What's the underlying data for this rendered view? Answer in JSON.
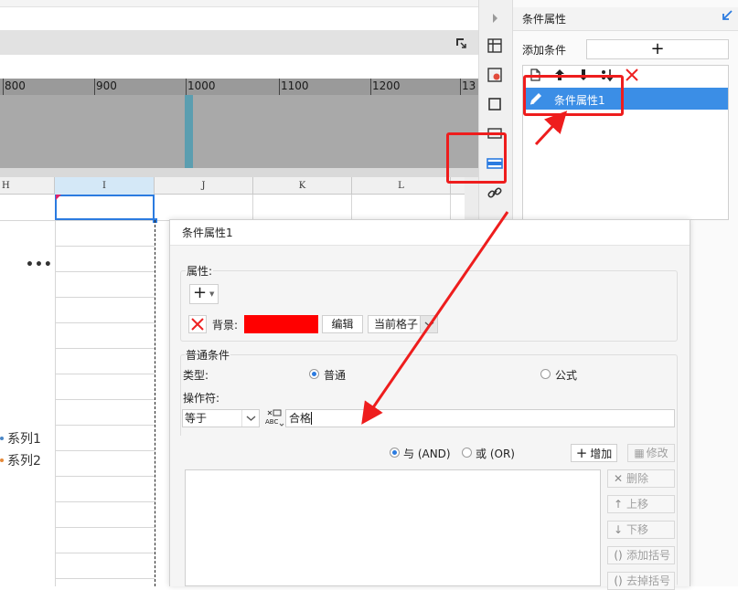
{
  "ruler": {
    "labels": [
      "800",
      "900",
      "1000",
      "1100",
      "1200",
      "13"
    ]
  },
  "sheet": {
    "columns": [
      "H",
      "I",
      "J",
      "K",
      "L"
    ],
    "more_dots": "•••",
    "legend": [
      {
        "label": "系列1",
        "color": "#4a86c5"
      },
      {
        "label": "系列2",
        "color": "#e58a3a"
      }
    ]
  },
  "right_panel": {
    "title": "条件属性",
    "add_condition_label": "添加条件",
    "add_button": "+",
    "list_items": [
      "条件属性1"
    ],
    "selected_index": 0
  },
  "dialog": {
    "title": "条件属性1",
    "property_section": {
      "label": "属性:",
      "add_button": "+",
      "row": {
        "type_label": "背景:",
        "color": "#ff0000",
        "edit_button": "编辑",
        "scope_value": "当前格子"
      }
    },
    "normal_condition": {
      "section_label": "普通条件",
      "type_label": "类型:",
      "type_options": [
        "普通",
        "公式"
      ],
      "type_selected": "普通",
      "operator_label": "操作符:",
      "operator_value": "等于",
      "value_input": "合格",
      "logic_options": [
        "与 (AND)",
        "或 (OR)"
      ],
      "logic_selected": "与 (AND)",
      "add_button": "增加",
      "modify_button": "修改",
      "side_buttons": [
        "删除",
        "上移",
        "下移",
        "添加括号",
        "去掉括号"
      ]
    }
  },
  "colors": {
    "accent": "#3b8ee6",
    "annotation": "#ee1d1d",
    "selection": "#2b7be0"
  }
}
